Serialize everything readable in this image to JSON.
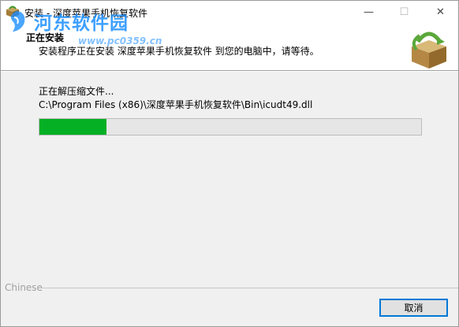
{
  "window": {
    "title": "安装 - 深度苹果手机恢复软件",
    "controls": {
      "minimize": "—",
      "maximize": "☐",
      "close": "✕"
    }
  },
  "header": {
    "title": "正在安装",
    "subtitle": "安装程序正在安装 深度苹果手机恢复软件 到您的电脑中，请等待。"
  },
  "watermark": {
    "text": "河东软件园",
    "url": "www.pc0359.cn"
  },
  "install": {
    "status": "正在解压缩文件...",
    "current_file": "C:\\Program Files (x86)\\深度苹果手机恢复软件\\Bin\\icudt49.dll",
    "progress_fraction": 0.175,
    "progress_color": "#06b025"
  },
  "footer": {
    "brand_label": "Chinese",
    "cancel_label": "取消"
  },
  "icons": {
    "app": "box-icon",
    "header_logo": "box-recycle-icon"
  }
}
